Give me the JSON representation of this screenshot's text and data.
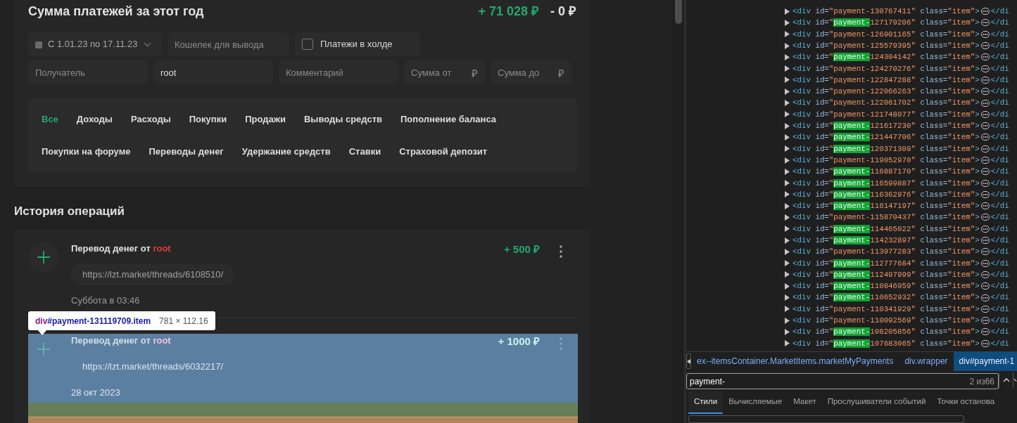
{
  "summary": {
    "title": "Сумма платежей за этот год",
    "income": "+ 71 028 ₽",
    "expense": "- 0 ₽"
  },
  "filters": {
    "date_range": "С 1.01.23 по 17.11.23",
    "wallet": {
      "placeholder": "Кошелек для вывода"
    },
    "hold": {
      "label": "Платежи в холде",
      "checked": false
    },
    "recipient": {
      "placeholder": "Получатель"
    },
    "sender": {
      "value": "root"
    },
    "comment": {
      "placeholder": "Комментарий"
    },
    "amount_from": {
      "placeholder": "Сумма от",
      "currency": "₽"
    },
    "amount_to": {
      "placeholder": "Сумма до",
      "currency": "₽"
    }
  },
  "category_rows": [
    [
      {
        "label": "Все",
        "selected": true
      },
      {
        "label": "Доходы",
        "selected": false
      },
      {
        "label": "Расходы",
        "selected": false
      },
      {
        "label": "Покупки",
        "selected": false
      },
      {
        "label": "Продажи",
        "selected": false
      },
      {
        "label": "Выводы средств",
        "selected": false
      },
      {
        "label": "Пополнение баланса",
        "selected": false
      }
    ],
    [
      {
        "label": "Покупки на форуме",
        "selected": false
      },
      {
        "label": "Переводы денег",
        "selected": false
      },
      {
        "label": "Удержание средств",
        "selected": false
      },
      {
        "label": "Ставки",
        "selected": false
      },
      {
        "label": "Страховой депозит",
        "selected": false
      }
    ]
  ],
  "history": {
    "title": "История операций",
    "items": [
      {
        "title": "Перевод денег от",
        "user": "root",
        "amount": "+ 500 ₽",
        "link": "https://lzt.market/threads/6108510/",
        "date": "Суббота в 03:46",
        "inspected": false
      },
      {
        "title": "Перевод денег от",
        "user": "root",
        "amount": "+ 1000 ₽",
        "link": "https://lzt.market/threads/6032217/",
        "date": "28 окт 2023",
        "inspected": true
      }
    ]
  },
  "inspect_tooltip": {
    "tag": "div",
    "selector": "#payment-131119709.item",
    "size": "781 × 112.16"
  },
  "devtools": {
    "nodes": [
      {
        "open": "<div",
        "id_attr": "id=\"",
        "match": "payment-",
        "id_rest": "130767411\"",
        "class_attr": "class=",
        "class_value": "\"item\"",
        "end": ">",
        "close": "</di",
        "highlighted": false
      },
      {
        "open": "<div",
        "id_attr": "id=\"",
        "match": "payment-",
        "id_rest": "127179206\"",
        "class_attr": "class=",
        "class_value": "\"item\"",
        "end": ">",
        "close": "</di",
        "highlighted": true
      },
      {
        "open": "<div",
        "id_attr": "id=\"",
        "match": "payment-",
        "id_rest": "126901165\"",
        "class_attr": "class=",
        "class_value": "\"item\"",
        "end": ">",
        "close": "</di",
        "highlighted": false
      },
      {
        "open": "<div",
        "id_attr": "id=\"",
        "match": "payment-",
        "id_rest": "125579395\"",
        "class_attr": "class=",
        "class_value": "\"item\"",
        "end": ">",
        "close": "</di",
        "highlighted": false
      },
      {
        "open": "<div",
        "id_attr": "id=\"",
        "match": "payment-",
        "id_rest": "124304142\"",
        "class_attr": "class=",
        "class_value": "\"item\"",
        "end": ">",
        "close": "</di",
        "highlighted": true
      },
      {
        "open": "<div",
        "id_attr": "id=\"",
        "match": "payment-",
        "id_rest": "124270276\"",
        "class_attr": "class=",
        "class_value": "\"item\"",
        "end": ">",
        "close": "</di",
        "highlighted": false
      },
      {
        "open": "<div",
        "id_attr": "id=\"",
        "match": "payment-",
        "id_rest": "122847288\"",
        "class_attr": "class=",
        "class_value": "\"item\"",
        "end": ">",
        "close": "</di",
        "highlighted": false
      },
      {
        "open": "<div",
        "id_attr": "id=\"",
        "match": "payment-",
        "id_rest": "122066263\"",
        "class_attr": "class=",
        "class_value": "\"item\"",
        "end": ">",
        "close": "</di",
        "highlighted": false
      },
      {
        "open": "<div",
        "id_attr": "id=\"",
        "match": "payment-",
        "id_rest": "122061702\"",
        "class_attr": "class=",
        "class_value": "\"item\"",
        "end": ">",
        "close": "</di",
        "highlighted": false
      },
      {
        "open": "<div",
        "id_attr": "id=\"",
        "match": "payment-",
        "id_rest": "121748077\"",
        "class_attr": "class=",
        "class_value": "\"item\"",
        "end": ">",
        "close": "</di",
        "highlighted": false
      },
      {
        "open": "<div",
        "id_attr": "id=\"",
        "match": "payment-",
        "id_rest": "121617230\"",
        "class_attr": "class=",
        "class_value": "\"item\"",
        "end": ">",
        "close": "</di",
        "highlighted": true
      },
      {
        "open": "<div",
        "id_attr": "id=\"",
        "match": "payment-",
        "id_rest": "121447706\"",
        "class_attr": "class=",
        "class_value": "\"item\"",
        "end": ">",
        "close": "</di",
        "highlighted": true
      },
      {
        "open": "<div",
        "id_attr": "id=\"",
        "match": "payment-",
        "id_rest": "120371309\"",
        "class_attr": "class=",
        "class_value": "\"item\"",
        "end": ">",
        "close": "</di",
        "highlighted": true
      },
      {
        "open": "<div",
        "id_attr": "id=\"",
        "match": "payment-",
        "id_rest": "119052970\"",
        "class_attr": "class=",
        "class_value": "\"item\"",
        "end": ">",
        "close": "</di",
        "highlighted": false
      },
      {
        "open": "<div",
        "id_attr": "id=\"",
        "match": "payment-",
        "id_rest": "116887170\"",
        "class_attr": "class=",
        "class_value": "\"item\"",
        "end": ">",
        "close": "</di",
        "highlighted": true
      },
      {
        "open": "<div",
        "id_attr": "id=\"",
        "match": "payment-",
        "id_rest": "116599887\"",
        "class_attr": "class=",
        "class_value": "\"item\"",
        "end": ">",
        "close": "</di",
        "highlighted": true
      },
      {
        "open": "<div",
        "id_attr": "id=\"",
        "match": "payment-",
        "id_rest": "116362976\"",
        "class_attr": "class=",
        "class_value": "\"item\"",
        "end": ">",
        "close": "</di",
        "highlighted": true
      },
      {
        "open": "<div",
        "id_attr": "id=\"",
        "match": "payment-",
        "id_rest": "116147197\"",
        "class_attr": "class=",
        "class_value": "\"item\"",
        "end": ">",
        "close": "</di",
        "highlighted": true
      },
      {
        "open": "<div",
        "id_attr": "id=\"",
        "match": "payment-",
        "id_rest": "115870437\"",
        "class_attr": "class=",
        "class_value": "\"item\"",
        "end": ">",
        "close": "</di",
        "highlighted": false
      },
      {
        "open": "<div",
        "id_attr": "id=\"",
        "match": "payment-",
        "id_rest": "114465022\"",
        "class_attr": "class=",
        "class_value": "\"item\"",
        "end": ">",
        "close": "</di",
        "highlighted": true
      },
      {
        "open": "<div",
        "id_attr": "id=\"",
        "match": "payment-",
        "id_rest": "114232897\"",
        "class_attr": "class=",
        "class_value": "\"item\"",
        "end": ">",
        "close": "</di",
        "highlighted": true
      },
      {
        "open": "<div",
        "id_attr": "id=\"",
        "match": "payment-",
        "id_rest": "113977283\"",
        "class_attr": "class=",
        "class_value": "\"item\"",
        "end": ">",
        "close": "</di",
        "highlighted": false
      },
      {
        "open": "<div",
        "id_attr": "id=\"",
        "match": "payment-",
        "id_rest": "112777684\"",
        "class_attr": "class=",
        "class_value": "\"item\"",
        "end": ">",
        "close": "</di",
        "highlighted": true
      },
      {
        "open": "<div",
        "id_attr": "id=\"",
        "match": "payment-",
        "id_rest": "112497999\"",
        "class_attr": "class=",
        "class_value": "\"item\"",
        "end": ">",
        "close": "</di",
        "highlighted": true
      },
      {
        "open": "<div",
        "id_attr": "id=\"",
        "match": "payment-",
        "id_rest": "110846959\"",
        "class_attr": "class=",
        "class_value": "\"item\"",
        "end": ">",
        "close": "</di",
        "highlighted": true
      },
      {
        "open": "<div",
        "id_attr": "id=\"",
        "match": "payment-",
        "id_rest": "110652932\"",
        "class_attr": "class=",
        "class_value": "\"item\"",
        "end": ">",
        "close": "</di",
        "highlighted": true
      },
      {
        "open": "<div",
        "id_attr": "id=\"",
        "match": "payment-",
        "id_rest": "110341929\"",
        "class_attr": "class=",
        "class_value": "\"item\"",
        "end": ">",
        "close": "</di",
        "highlighted": false
      },
      {
        "open": "<div",
        "id_attr": "id=\"",
        "match": "payment-",
        "id_rest": "110092569\"",
        "class_attr": "class=",
        "class_value": "\"item\"",
        "end": ">",
        "close": "</di",
        "highlighted": false
      },
      {
        "open": "<div",
        "id_attr": "id=\"",
        "match": "payment-",
        "id_rest": "108205856\"",
        "class_attr": "class=",
        "class_value": "\"item\"",
        "end": ">",
        "close": "</di",
        "highlighted": true
      },
      {
        "open": "<div",
        "id_attr": "id=\"",
        "match": "payment-",
        "id_rest": "107683065\"",
        "class_attr": "class=",
        "class_value": "\"item\"",
        "end": ">",
        "close": "</di",
        "highlighted": true
      }
    ],
    "breadcrumbs": [
      {
        "label": "ex--itemsContainer.MarketItems.marketMyPayments",
        "selected": false
      },
      {
        "label": "div.wrapper",
        "selected": false
      },
      {
        "label": "div#payment-1",
        "selected": true
      }
    ],
    "search": {
      "value": "payment-",
      "count": "2 из66"
    },
    "tabs": [
      {
        "label": "Стили",
        "selected": true
      },
      {
        "label": "Вычисляемые",
        "selected": false
      },
      {
        "label": "Макет",
        "selected": false
      },
      {
        "label": "Прослушиватели событий",
        "selected": false
      },
      {
        "label": "Точки останова",
        "selected": false
      }
    ]
  }
}
